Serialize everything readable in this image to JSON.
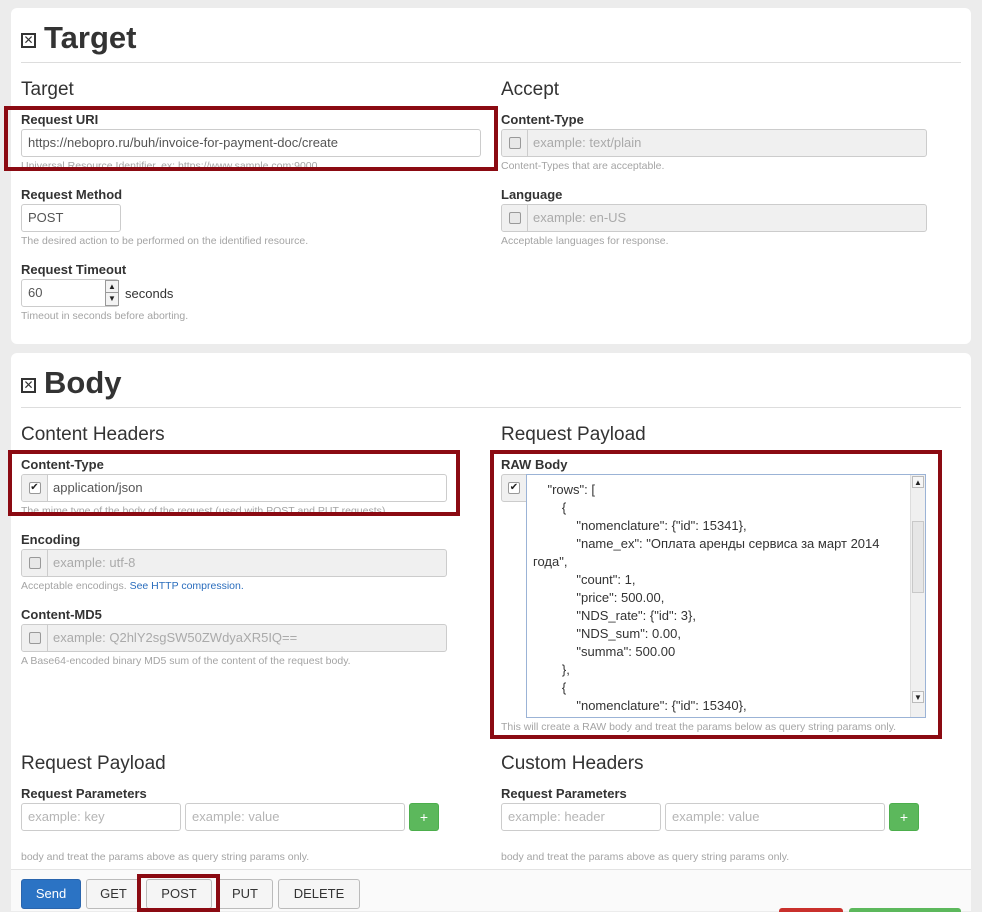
{
  "target_panel": {
    "title": "Target",
    "target_section": {
      "heading": "Target",
      "request_uri": {
        "label": "Request URI",
        "value": "https://nebopro.ru/buh/invoice-for-payment-doc/create",
        "help": "Universal Resource Identifier. ex: https://www.sample.com:9000"
      },
      "request_method": {
        "label": "Request Method",
        "value": "POST",
        "help": "The desired action to be performed on the identified resource."
      },
      "request_timeout": {
        "label": "Request Timeout",
        "value": "60",
        "unit": "seconds",
        "help": "Timeout in seconds before aborting."
      }
    },
    "accept_section": {
      "heading": "Accept",
      "content_type": {
        "label": "Content-Type",
        "placeholder": "example: text/plain",
        "checked": false,
        "help": "Content-Types that are acceptable."
      },
      "language": {
        "label": "Language",
        "placeholder": "example: en-US",
        "checked": false,
        "help": "Acceptable languages for response."
      }
    }
  },
  "body_panel": {
    "title": "Body",
    "content_headers": {
      "heading": "Content Headers",
      "content_type": {
        "label": "Content-Type",
        "value": "application/json",
        "checked": true,
        "help": "The mime type of the body of the request (used with POST and PUT requests)."
      },
      "encoding": {
        "label": "Encoding",
        "placeholder": "example: utf-8",
        "checked": false,
        "help": "Acceptable encodings.",
        "help_link": "See HTTP compression."
      },
      "content_md5": {
        "label": "Content-MD5",
        "placeholder": "example: Q2hlY2sgSW50ZWdyaXR5IQ==",
        "checked": false,
        "help": "A Base64-encoded binary MD5 sum of the content of the request body."
      }
    },
    "request_payload": {
      "heading": "Request Payload",
      "raw_body": {
        "label": "RAW Body",
        "checked": true,
        "text": "    \"rows\": [\n        {\n            \"nomenclature\": {\"id\": 15341},\n            \"name_ex\": \"Оплата аренды сервиса за март 2014 года\",\n            \"count\": 1,\n            \"price\": 500.00,\n            \"NDS_rate\": {\"id\": 3},\n            \"NDS_sum\": 0.00,\n            \"summa\": 500.00\n        },\n        {\n            \"nomenclature\": {\"id\": 15340},",
        "help": "This will create a RAW body and treat the params below as query string params only."
      }
    },
    "request_payload_params": {
      "heading": "Request Payload",
      "label": "Request Parameters",
      "key_placeholder": "example: key",
      "value_placeholder": "example: value",
      "add_label": "+",
      "help": "body and treat the params above as query string params only."
    },
    "custom_headers": {
      "heading": "Custom Headers",
      "label": "Request Parameters",
      "key_placeholder": "example: header",
      "value_placeholder": "example: value",
      "add_label": "+",
      "help": "body and treat the params above as query string params only."
    }
  },
  "actions": {
    "send": "Send",
    "get": "GET",
    "post": "POST",
    "put": "PUT",
    "delete": "DELETE"
  },
  "colors": {
    "highlight": "#8b0a12",
    "primary": "#2b73c4",
    "add": "#5cb85c"
  }
}
